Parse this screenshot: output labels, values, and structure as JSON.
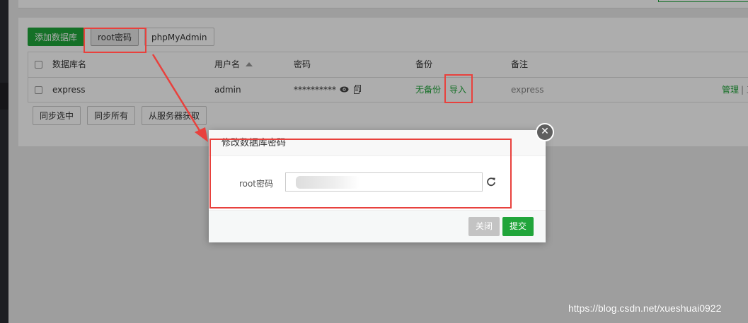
{
  "toolbar": {
    "add_db_label": "添加数据库",
    "root_password_label": "root密码",
    "phpmyadmin_label": "phpMyAdmin"
  },
  "table": {
    "headers": {
      "name": "数据库名",
      "username": "用户名",
      "password": "密码",
      "backup": "备份",
      "note": "备注"
    },
    "rows": [
      {
        "name": "express",
        "username": "admin",
        "password": "**********",
        "backup_status": "无备份",
        "import_label": "导入",
        "note": "express",
        "manage_label": "管理",
        "extra_label": "| 工"
      }
    ]
  },
  "bottom_buttons": {
    "sync_selected": "同步选中",
    "sync_all": "同步所有",
    "fetch_from_server": "从服务器获取"
  },
  "dialog": {
    "title": "修改数据库密码",
    "field_label": "root密码",
    "field_value": "",
    "close_label": "关闭",
    "submit_label": "提交",
    "close_icon_glyph": "✕"
  },
  "watermark": "https://blog.csdn.net/xueshuai0922",
  "colors": {
    "accent_green": "#20a53a",
    "annotation_red": "#e8413d"
  }
}
